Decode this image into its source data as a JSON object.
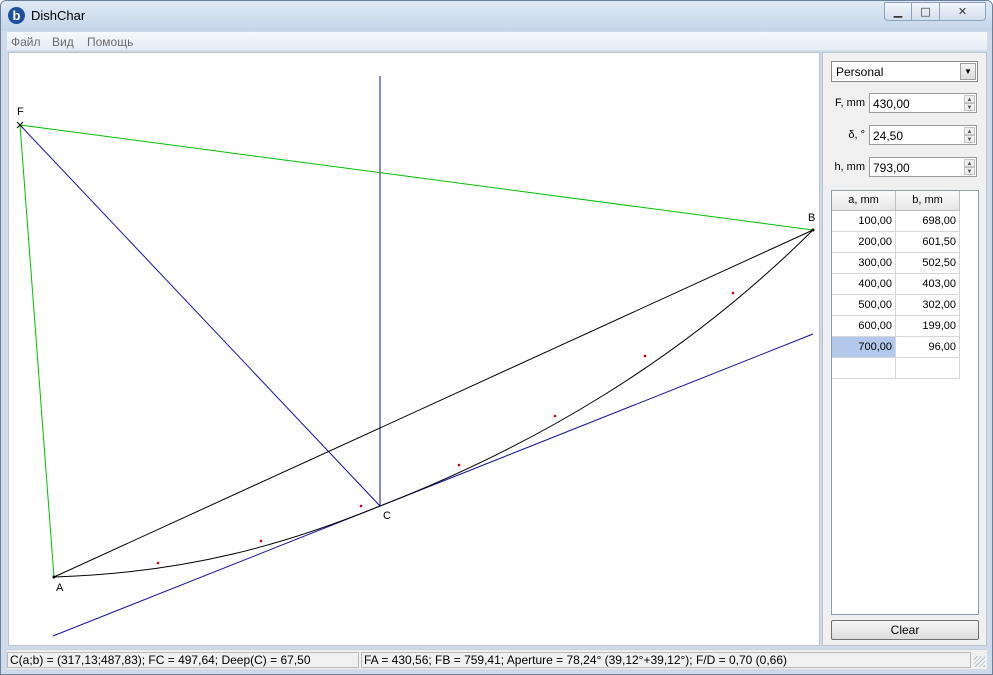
{
  "window": {
    "title": "DishChar",
    "icon": "app-logo-icon"
  },
  "controls": {
    "minimize": "▁",
    "maximize": "□",
    "close": "✕"
  },
  "menu": [
    "Файл",
    "Вид",
    "Помощь"
  ],
  "panel": {
    "profile": "Personal",
    "fields": [
      {
        "label": "F, mm",
        "value": "430,00"
      },
      {
        "label": "δ, °",
        "value": "24,50"
      },
      {
        "label": "h, mm",
        "value": "793,00"
      }
    ],
    "table": {
      "headers": [
        "a, mm",
        "b, mm"
      ],
      "rows": [
        [
          "100,00",
          "698,00"
        ],
        [
          "200,00",
          "601,50"
        ],
        [
          "300,00",
          "502,50"
        ],
        [
          "400,00",
          "403,00"
        ],
        [
          "500,00",
          "302,00"
        ],
        [
          "600,00",
          "199,00"
        ],
        [
          "700,00",
          "96,00"
        ]
      ],
      "selected_row": 6
    },
    "clear_label": "Clear"
  },
  "diagram": {
    "point_labels": {
      "F": "F",
      "A": "A",
      "B": "B",
      "C": "C"
    },
    "colors": {
      "line": "#000000",
      "green": "#00c000",
      "blue": "#1010a0",
      "points": "#d00000"
    }
  },
  "status": {
    "left": "C(a;b) = (317,13;487,83); FC = 497,64; Deep(C) = 67,50",
    "right": "FA = 430,56; FB = 759,41; Aperture = 78,24° (39,12°+39,12°); F/D = 0,70 (0,66)"
  }
}
